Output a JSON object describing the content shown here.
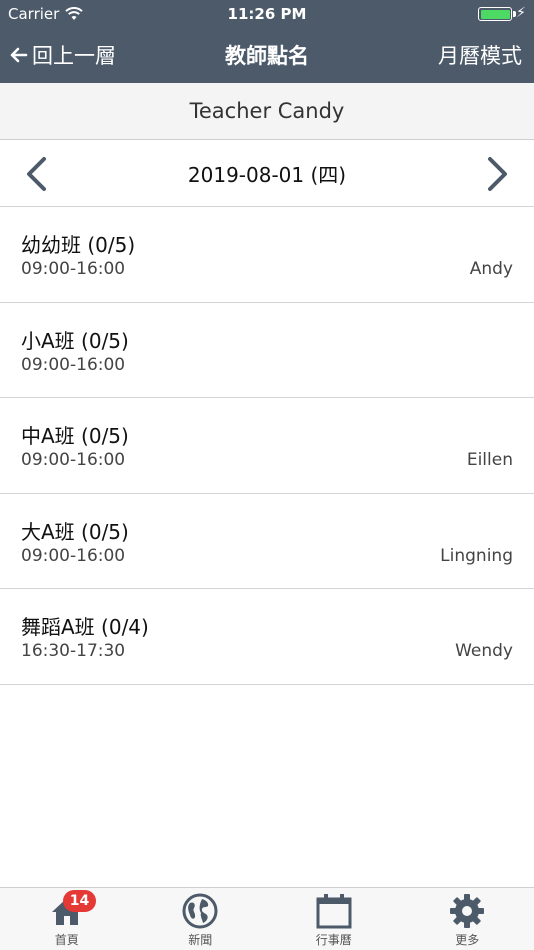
{
  "status_bar": {
    "carrier": "Carrier",
    "time": "11:26 PM"
  },
  "navbar": {
    "back_label": "回上一層",
    "title": "教師點名",
    "right_label": "月曆模式"
  },
  "teacher": {
    "name": "Teacher Candy"
  },
  "date_bar": {
    "date": "2019-08-01 (四)"
  },
  "classes": [
    {
      "name": "幼幼班 (0/5)",
      "time": "09:00-16:00",
      "teacher": "Andy"
    },
    {
      "name": "小A班 (0/5)",
      "time": "09:00-16:00",
      "teacher": ""
    },
    {
      "name": "中A班 (0/5)",
      "time": "09:00-16:00",
      "teacher": "Eillen"
    },
    {
      "name": "大A班 (0/5)",
      "time": "09:00-16:00",
      "teacher": "Lingning"
    },
    {
      "name": "舞蹈A班 (0/4)",
      "time": "16:30-17:30",
      "teacher": "Wendy"
    }
  ],
  "tabbar": {
    "tabs": [
      {
        "label": "首頁",
        "icon": "home-icon",
        "badge": "14"
      },
      {
        "label": "新聞",
        "icon": "globe-icon"
      },
      {
        "label": "行事曆",
        "icon": "calendar-icon"
      },
      {
        "label": "更多",
        "icon": "gear-icon"
      }
    ]
  },
  "colors": {
    "header_bg": "#4c5a6a",
    "accent_arrow": "#4c5a6a",
    "tab_icon": "#4c5a6a",
    "badge": "#e53935",
    "battery": "#4cd964"
  }
}
